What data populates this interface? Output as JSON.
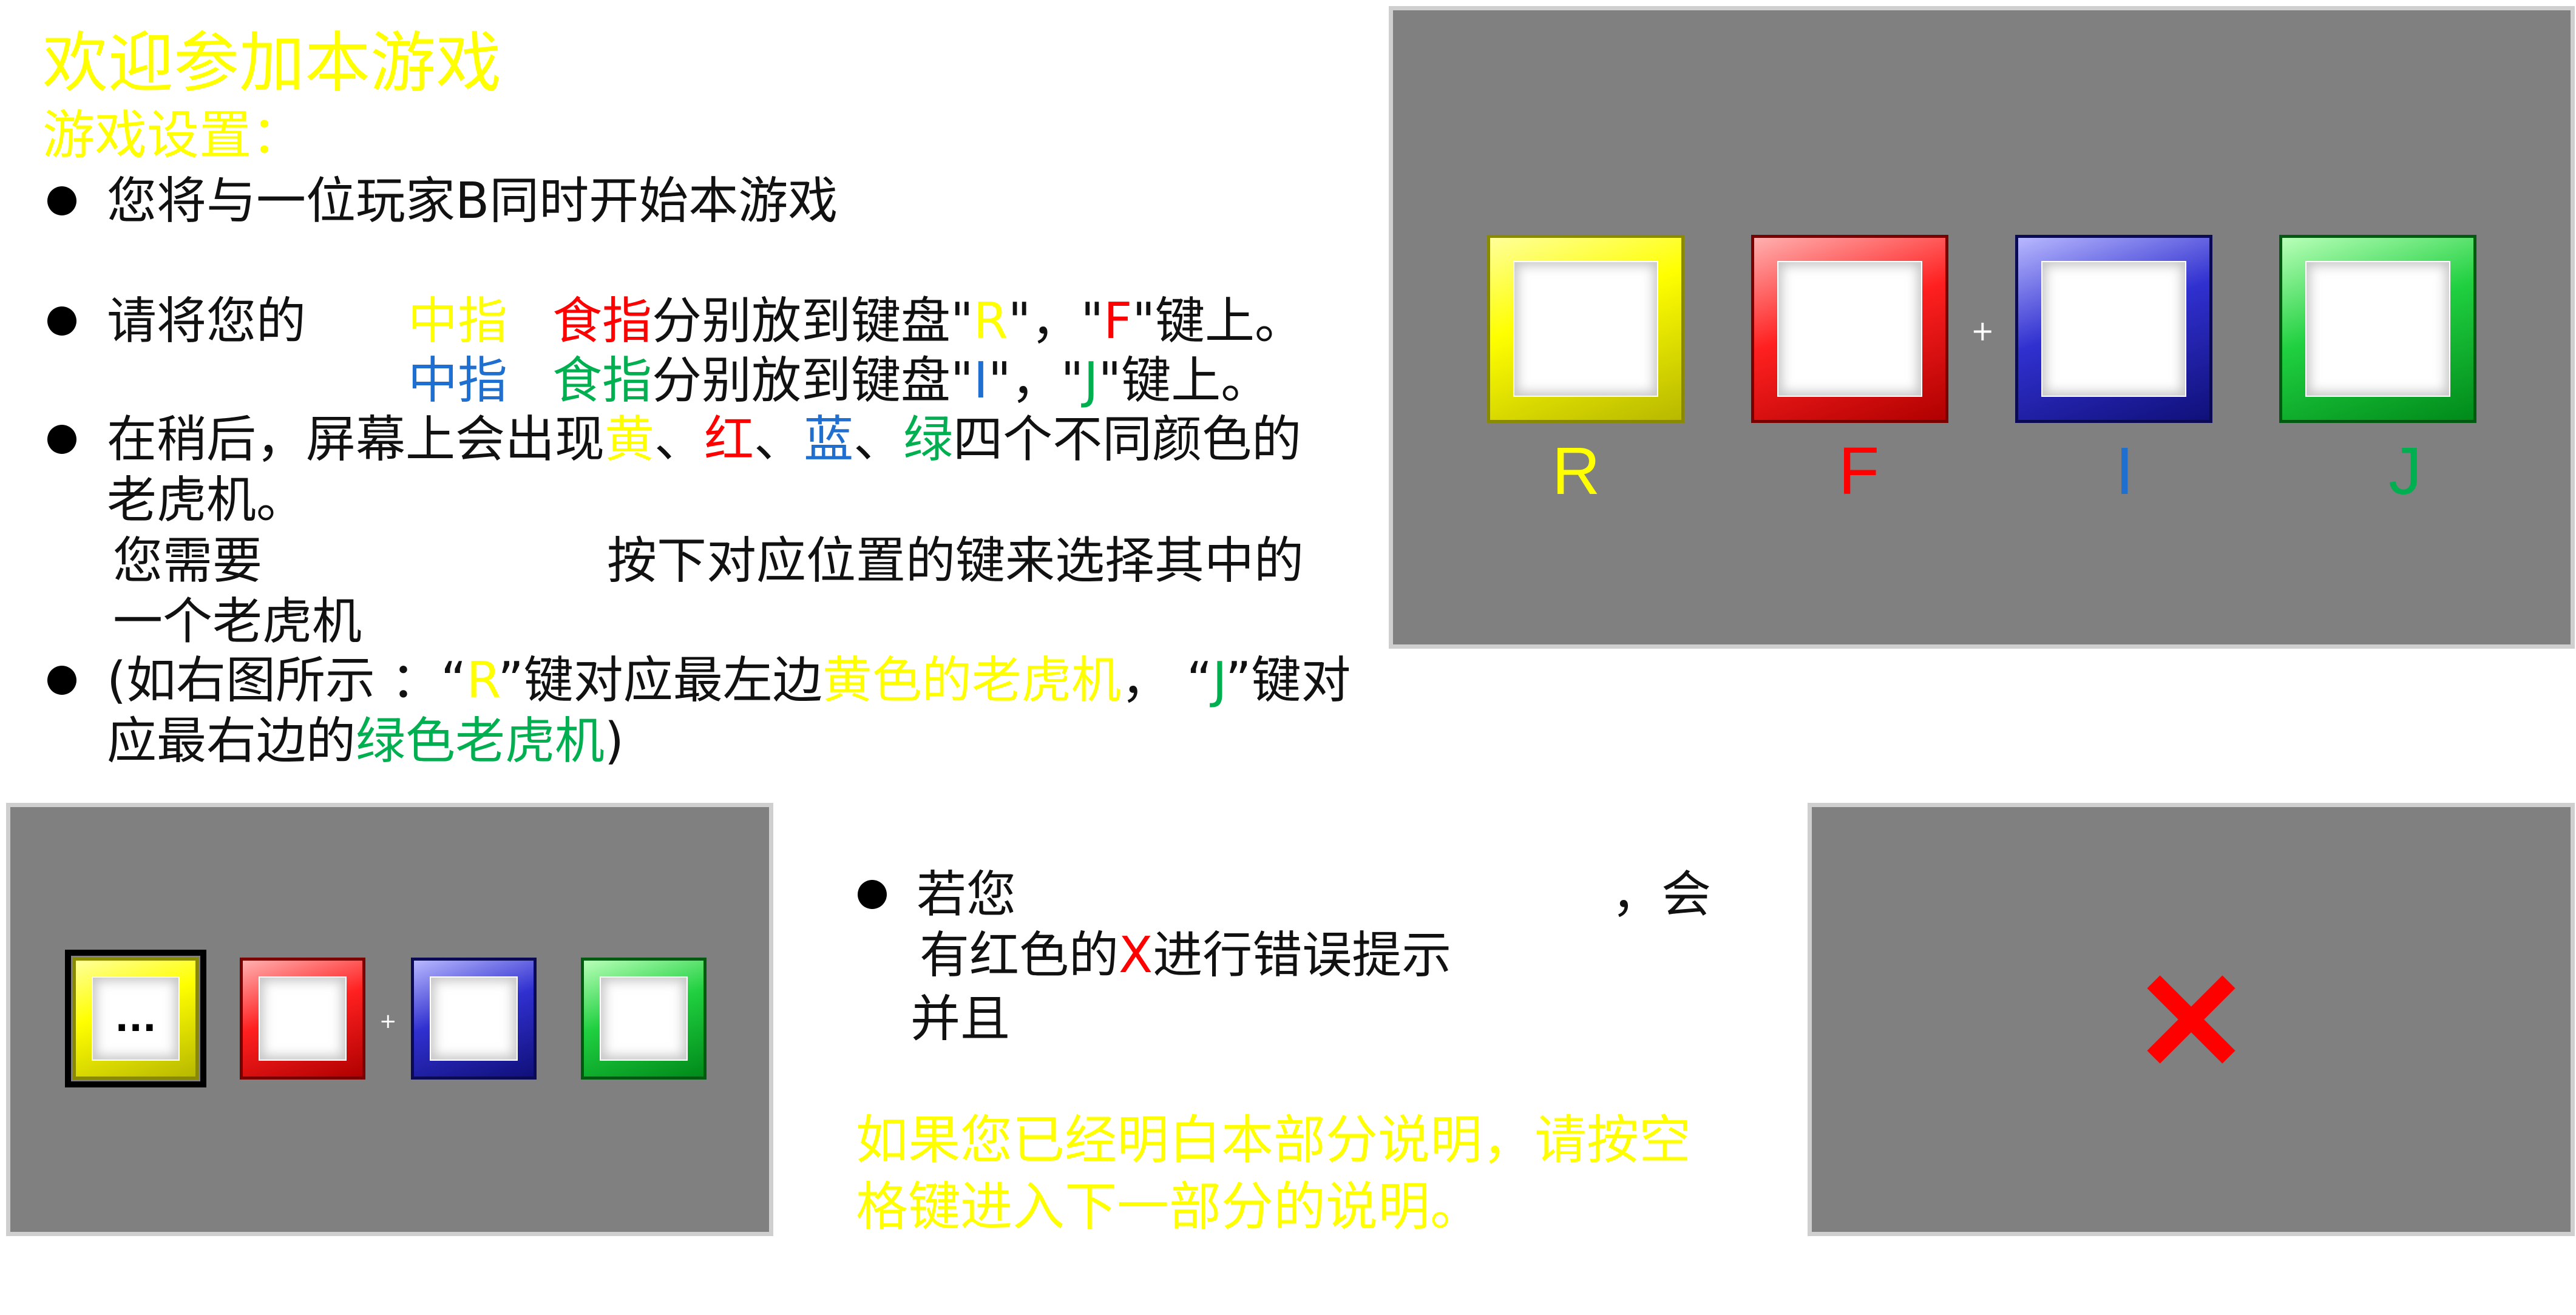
{
  "colors": {
    "yellow": "#ffff00",
    "red": "#ff0000",
    "blue": "#1f6fd0",
    "green": "#00b050",
    "text": "#111111",
    "panel": "#808080"
  },
  "header": {
    "title": "欢迎参加本游戏",
    "subtitle": "游戏设置："
  },
  "instructions": {
    "b1": "您将与一位玩家B同时开始本游戏",
    "b2": {
      "prefix": "请将您的",
      "l1": {
        "c1": "中指",
        "c2": "食指",
        "mid": "分别放到键盘\"",
        "k1": "R",
        "sep": "\"，\"",
        "k2": "F",
        "end": "\"键上。"
      },
      "l2": {
        "c1": "中指",
        "c2": "食指",
        "mid": "分别放到键盘\"",
        "k1": "I",
        "sep": "\"，\"",
        "k2": "J",
        "end": "\"键上。"
      }
    },
    "b3": {
      "a": "在稍后，屏幕上会出现",
      "yellow": "黄",
      "sep1": "、",
      "red": "红",
      "sep2": "、",
      "blue": "蓝",
      "sep3": "、",
      "green": "绿",
      "b": "四个不同颜色的",
      "c": "老虎机。",
      "d1": "您需要",
      "d2": "按下对应位置的键来选择其中的",
      "e": "一个老虎机"
    },
    "b4": {
      "a": "(如右图所示 ：“",
      "k1": "R",
      "b": "”键对应最左边",
      "c": "黄色的老虎机",
      "d": "，  “",
      "k2": "J",
      "e": "”键对",
      "f": "应最右边的",
      "g": "绿色老虎机",
      "h": ")"
    }
  },
  "top_panel": {
    "plus": "+",
    "keys": [
      "R",
      "F",
      "I",
      "J"
    ]
  },
  "bottom_left_panel": {
    "plus": "+",
    "selected_marker": "..."
  },
  "middle_text": {
    "a1": "若您",
    "a2": "，会",
    "b1": "有红色的",
    "bx": "X",
    "b2": "进行错误提示",
    "c": "并且",
    "footer": "如果您已经明白本部分说明，请按空格键进入下一部分的说明。",
    "footer_l1": "如果您已经明白本部分说明，请按空",
    "footer_l2": "格键进入下一部分的说明。"
  },
  "bottom_right_panel": {
    "error_mark": "✕"
  }
}
